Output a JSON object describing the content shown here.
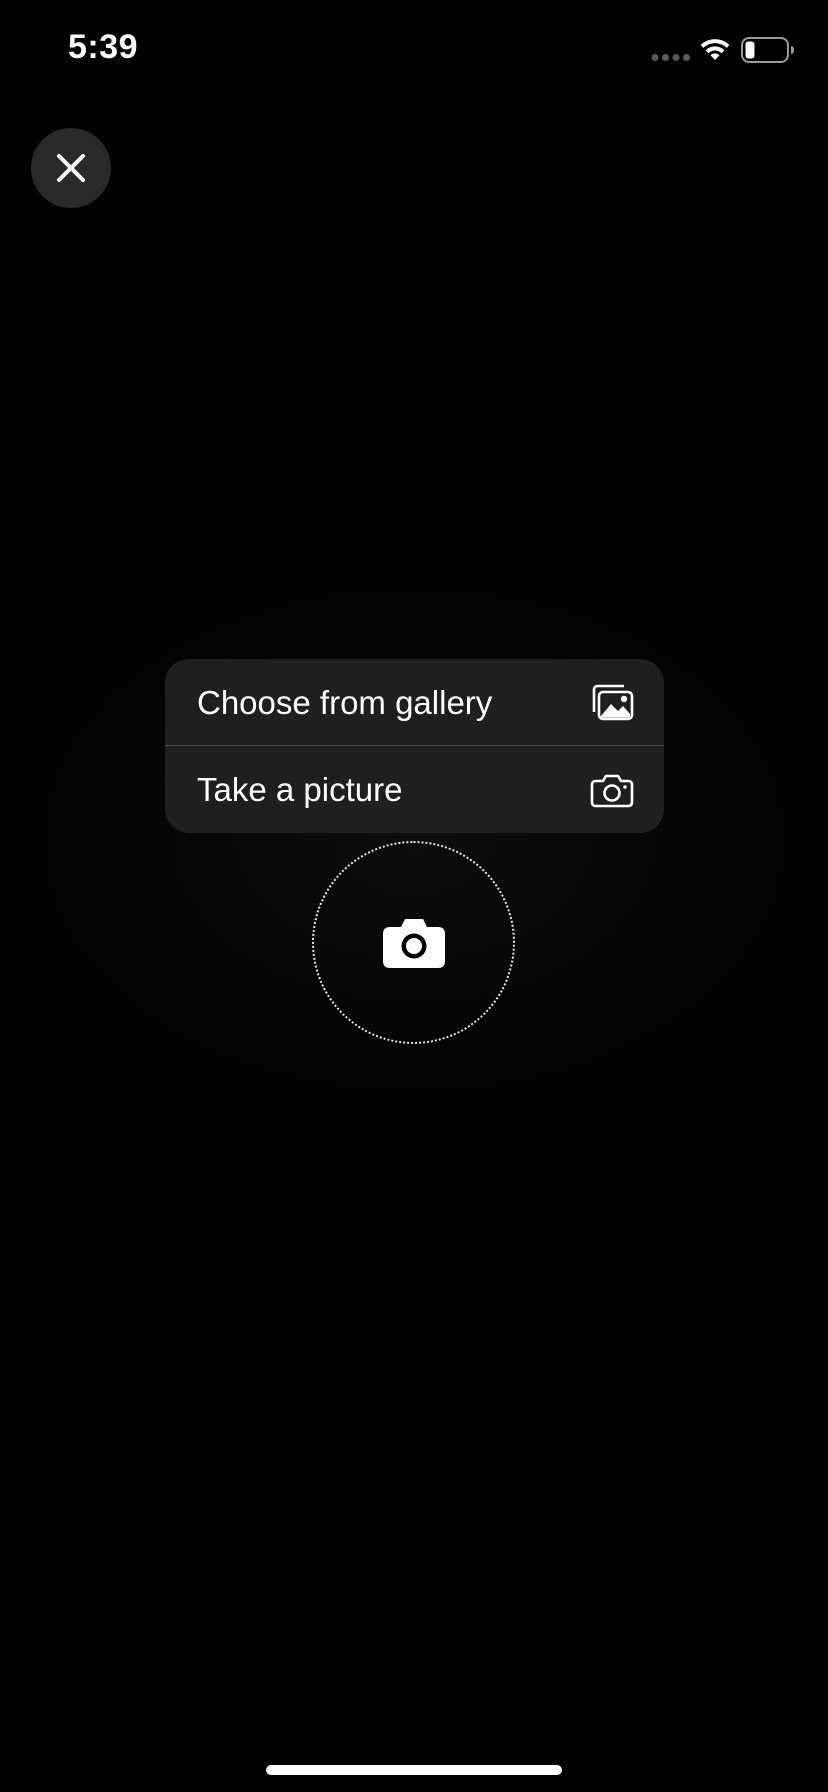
{
  "status_bar": {
    "time": "5:39",
    "battery_level": 0.2
  },
  "close_button": {
    "icon": "close-icon"
  },
  "menu": {
    "items": [
      {
        "label": "Choose from gallery",
        "icon": "gallery-icon"
      },
      {
        "label": "Take a picture",
        "icon": "camera-outline-icon"
      }
    ]
  },
  "camera_button": {
    "icon": "camera-icon"
  },
  "colors": {
    "background": "#000000",
    "menu_background": "#1f1f1f",
    "close_button_background": "#2a2a2a",
    "text": "#ffffff"
  }
}
